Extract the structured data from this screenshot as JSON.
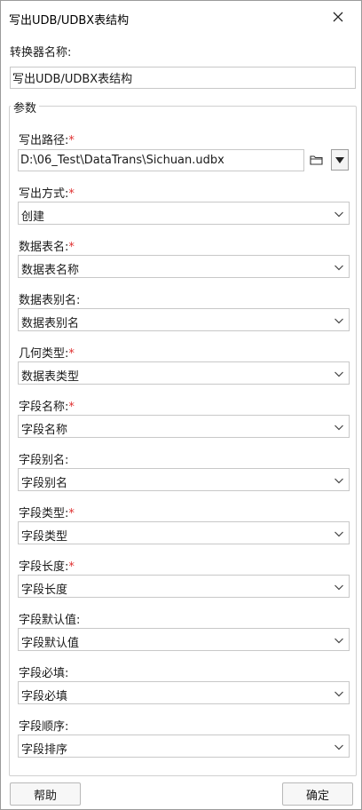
{
  "window": {
    "title": "写出UDB/UDBX表结构"
  },
  "converter": {
    "label": "转换器名称:",
    "value": "写出UDB/UDBX表结构"
  },
  "params": {
    "legend": "参数",
    "output_path": {
      "label": "写出路径:",
      "required_mark": "*",
      "value": "D:\\06_Test\\DataTrans\\Sichuan.udbx"
    },
    "fields": [
      {
        "label": "写出方式:",
        "required_mark": "*",
        "value": "创建"
      },
      {
        "label": "数据表名:",
        "required_mark": "*",
        "value": "数据表名称"
      },
      {
        "label": "数据表别名:",
        "required_mark": "",
        "value": "数据表别名"
      },
      {
        "label": "几何类型:",
        "required_mark": "*",
        "value": "数据表类型"
      },
      {
        "label": "字段名称:",
        "required_mark": "*",
        "value": "字段名称"
      },
      {
        "label": "字段别名:",
        "required_mark": "",
        "value": "字段别名"
      },
      {
        "label": "字段类型:",
        "required_mark": "*",
        "value": "字段类型"
      },
      {
        "label": "字段长度:",
        "required_mark": "*",
        "value": "字段长度"
      },
      {
        "label": "字段默认值:",
        "required_mark": "",
        "value": "字段默认值"
      },
      {
        "label": "字段必填:",
        "required_mark": "",
        "value": "字段必填"
      },
      {
        "label": "字段顺序:",
        "required_mark": "",
        "value": "字段排序"
      }
    ]
  },
  "footer": {
    "help_label": "帮助",
    "ok_label": "确定"
  },
  "icons": {
    "close": "close-icon",
    "folder": "folder-icon",
    "dropdown": "triangle-down-icon",
    "chevron": "chevron-down-icon"
  },
  "colors": {
    "required": "#e03030",
    "border": "#c8c8c8"
  }
}
